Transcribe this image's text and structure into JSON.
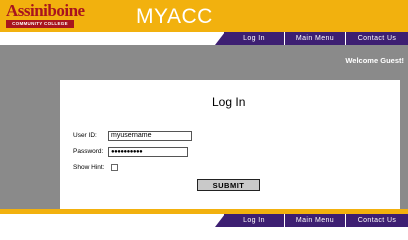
{
  "header": {
    "logo_name": "Assiniboine",
    "logo_subtitle": "COMMUNITY COLLEGE",
    "app_title": "MYACC"
  },
  "nav": {
    "items": [
      "Log In",
      "Main Menu",
      "Contact Us"
    ]
  },
  "welcome_text": "Welcome Guest!",
  "login": {
    "title": "Log In",
    "user_id_label": "User ID:",
    "user_id_value": "myusername",
    "password_label": "Password:",
    "password_value": "●●●●●●●●●●",
    "show_hint_label": "Show Hint:",
    "submit_label": "SUBMIT"
  },
  "colors": {
    "brand_yellow": "#f2b10e",
    "brand_purple": "#3d1f72",
    "logo_red": "#a8141e",
    "background_gray": "#8a8a8a"
  }
}
